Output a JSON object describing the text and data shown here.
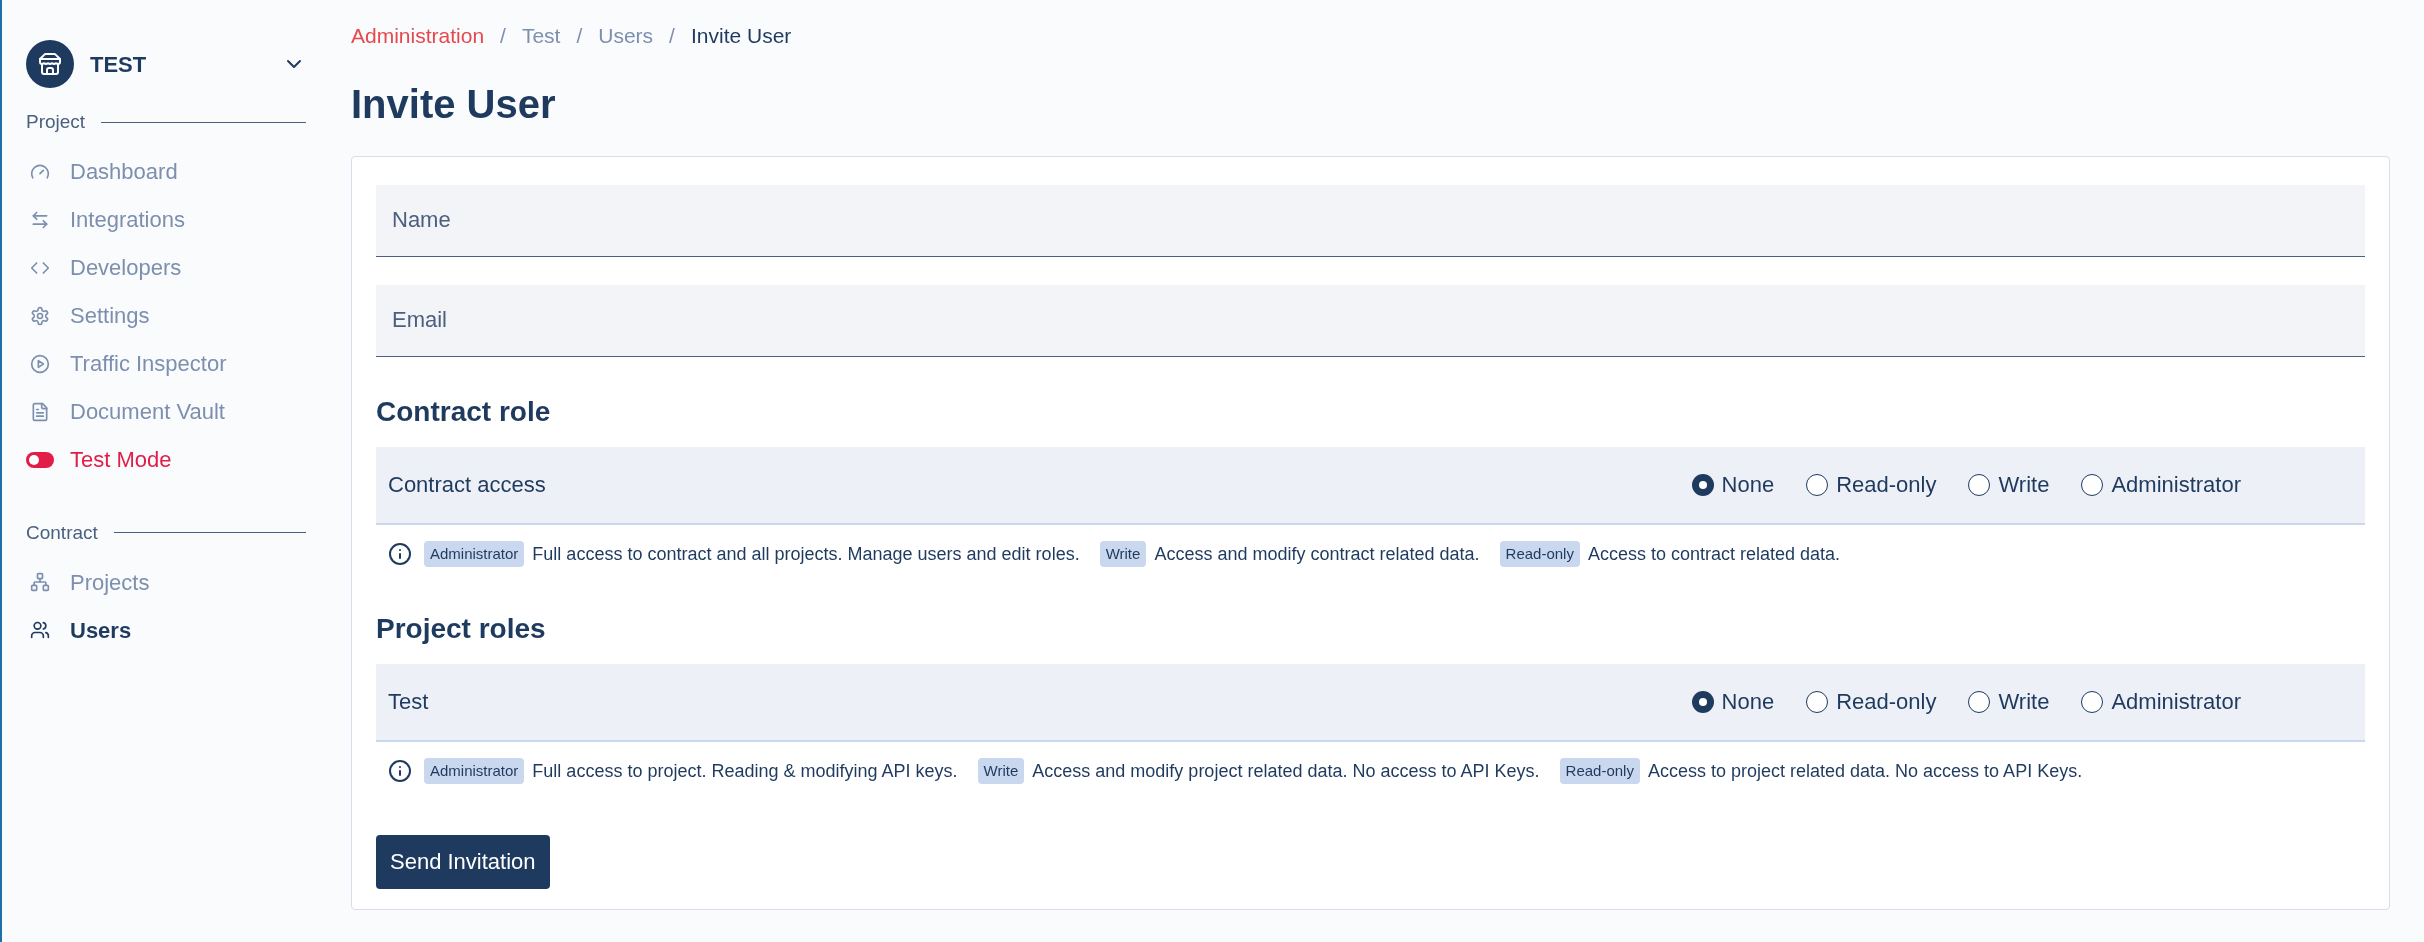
{
  "sidebar": {
    "workspace": {
      "name": "TEST",
      "expanded": false
    },
    "sections": [
      {
        "title": "Project",
        "items": [
          {
            "label": "Dashboard",
            "kind": "dashboard",
            "selected": false
          },
          {
            "label": "Integrations",
            "kind": "integrations",
            "selected": false
          },
          {
            "label": "Developers",
            "kind": "developers",
            "selected": false
          },
          {
            "label": "Settings",
            "kind": "settings",
            "selected": false
          },
          {
            "label": "Traffic Inspector",
            "kind": "traffic",
            "selected": false
          },
          {
            "label": "Document Vault",
            "kind": "document",
            "selected": false
          },
          {
            "label": "Test Mode",
            "kind": "testmode",
            "selected": false
          }
        ]
      },
      {
        "title": "Contract",
        "items": [
          {
            "label": "Projects",
            "kind": "projects",
            "selected": false
          },
          {
            "label": "Users",
            "kind": "users",
            "selected": true
          }
        ]
      }
    ]
  },
  "breadcrumb": [
    {
      "label": "Administration",
      "kind": "link"
    },
    {
      "label": "Test",
      "kind": "crumb"
    },
    {
      "label": "Users",
      "kind": "crumb"
    },
    {
      "label": "Invite User",
      "kind": "current"
    }
  ],
  "separator": "/",
  "title": "Invite User",
  "fields": [
    {
      "placeholder": "Name"
    },
    {
      "placeholder": "Email"
    }
  ],
  "role_sections": [
    {
      "title": "Contract role",
      "rows": [
        {
          "label": "Contract access",
          "options": [
            {
              "label": "None",
              "selected": true
            },
            {
              "label": "Read-only",
              "selected": false
            },
            {
              "label": "Write",
              "selected": false
            },
            {
              "label": "Administrator",
              "selected": false
            }
          ]
        }
      ],
      "info": [
        {
          "badge": "Administrator",
          "text": "Full access to contract and all projects. Manage users and edit roles."
        },
        {
          "badge": "Write",
          "text": "Access and modify contract related data."
        },
        {
          "badge": "Read-only",
          "text": "Access to contract related data."
        }
      ]
    },
    {
      "title": "Project roles",
      "rows": [
        {
          "label": "Test",
          "options": [
            {
              "label": "None",
              "selected": true
            },
            {
              "label": "Read-only",
              "selected": false
            },
            {
              "label": "Write",
              "selected": false
            },
            {
              "label": "Administrator",
              "selected": false
            }
          ]
        }
      ],
      "info": [
        {
          "badge": "Administrator",
          "text": "Full access to project. Reading & modifying API keys."
        },
        {
          "badge": "Write",
          "text": "Access and modify project related data. No access to API Keys."
        },
        {
          "badge": "Read-only",
          "text": "Access to project related data. No access to API Keys."
        }
      ]
    }
  ],
  "submit": "Send Invitation"
}
